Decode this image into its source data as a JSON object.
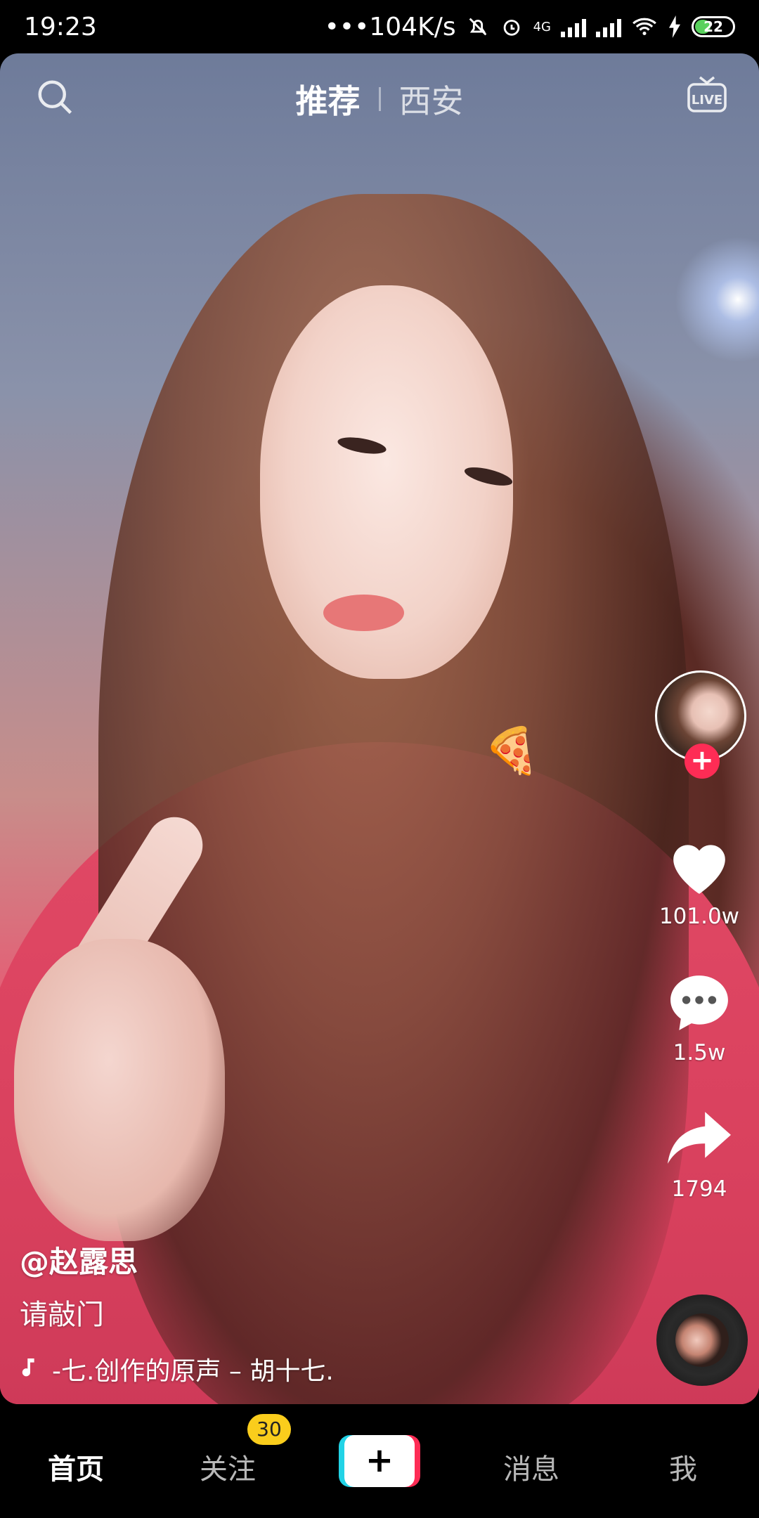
{
  "status_bar": {
    "time": "19:23",
    "network_speed": "•••104K/s",
    "network_type": "4G",
    "battery": "22"
  },
  "top_nav": {
    "tabs": [
      {
        "label": "推荐",
        "active": true
      },
      {
        "label": "西安",
        "active": false
      }
    ],
    "search_icon": "search-icon",
    "live_icon": "live-icon"
  },
  "video": {
    "author": "@赵露思",
    "caption": "请敲门",
    "music": "-七.创作的原声 – 胡十七."
  },
  "actions": {
    "likes": "101.0w",
    "comments": "1.5w",
    "shares": "1794"
  },
  "bottom_nav": {
    "items": [
      {
        "label": "首页",
        "active": true
      },
      {
        "label": "关注",
        "active": false
      },
      {
        "label": "消息",
        "active": false
      },
      {
        "label": "我",
        "active": false
      }
    ],
    "follow_badge": "30",
    "create_label": "+"
  },
  "colors": {
    "accent_red": "#fe2c55",
    "accent_cyan": "#22d3e6",
    "badge_yellow": "#facd1c"
  }
}
